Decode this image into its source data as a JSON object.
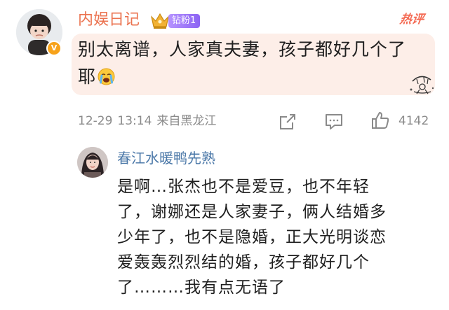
{
  "comment": {
    "username": "内娱日记",
    "fan_badge": "钻粉1",
    "hot_tag": "热评",
    "text_line1": "别太离谱，人家真夫妻，孩子都好几个了",
    "text_line2": "耶",
    "emoji": "loudly-crying-face",
    "date": "12-29",
    "time": "13:14",
    "location": "来自黑龙江",
    "like_count": "4142"
  },
  "reply": {
    "username": "春江水暖鸭先熟",
    "lines": [
      "是啊…张杰也不是爱豆，也不年轻",
      "了，谢娜还是人家妻子，俩人结婚多",
      "少年了，也不是隐婚，正大光明谈恋",
      "爱轰轰烈烈结的婚，孩子都好几个",
      "了………我有点无语了"
    ]
  },
  "colors": {
    "username_main": "#eb7350",
    "username_reply": "#4b78a8",
    "bubble": "#fdeee8",
    "meta": "#8a8a8a",
    "badge_purple": "#8c63f3",
    "hot": "#f46a53",
    "verified": "#f7a21a"
  },
  "icons": [
    "crown-icon",
    "verified-v-icon",
    "share-icon",
    "comment-icon",
    "like-icon",
    "sketch-decoration-icon"
  ]
}
